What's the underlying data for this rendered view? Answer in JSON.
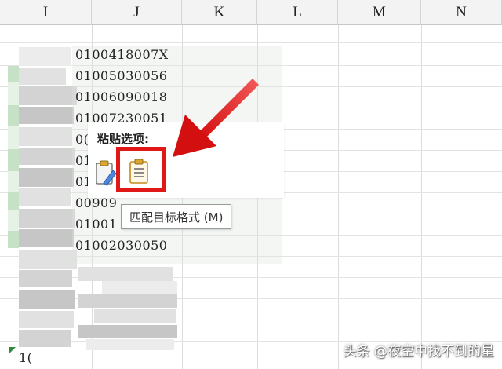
{
  "columns": [
    "I",
    "J",
    "K",
    "L",
    "M",
    "N"
  ],
  "cells": [
    "0100418007X",
    "01005030056",
    "01006090018",
    "01007230051",
    "0(",
    "01",
    "01",
    "00909",
    "01001",
    "01002030050"
  ],
  "bottom_cell": "1(",
  "paste_menu": {
    "title": "粘贴选项:",
    "tooltip": "匹配目标格式 (M)",
    "icons": [
      "paste-keep-source-format-icon",
      "paste-match-destination-format-icon"
    ]
  },
  "colors": {
    "highlight": "#e01818",
    "row_marker": "#c7e1c7",
    "header_bg": "#f3f3f3"
  },
  "watermark": "头条 @夜空中找不到的星"
}
